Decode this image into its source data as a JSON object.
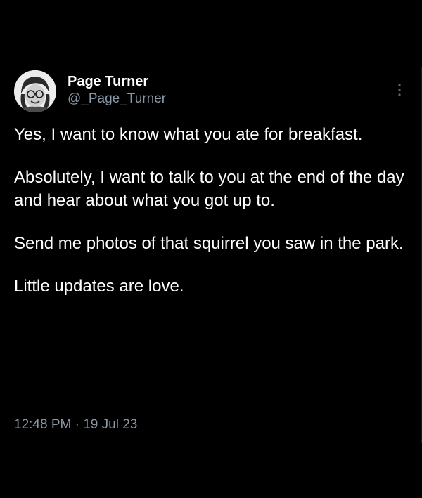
{
  "tweet": {
    "author": {
      "display_name": "Page Turner",
      "handle": "@_Page_Turner"
    },
    "paragraphs": [
      "Yes, I want to know what you ate for breakfast.",
      "Absolutely, I want to talk to you at the end of the day and hear about what you got up to.",
      "Send me photos of that squirrel you saw in the park.",
      "Little updates are love."
    ],
    "time": "12:48 PM",
    "separator": "·",
    "date": "19 Jul 23",
    "icons": {
      "avatar": "avatar",
      "more": "more-options-icon"
    },
    "colors": {
      "background": "#000000",
      "text": "#ffffff",
      "secondary": "#8b98a5"
    }
  }
}
